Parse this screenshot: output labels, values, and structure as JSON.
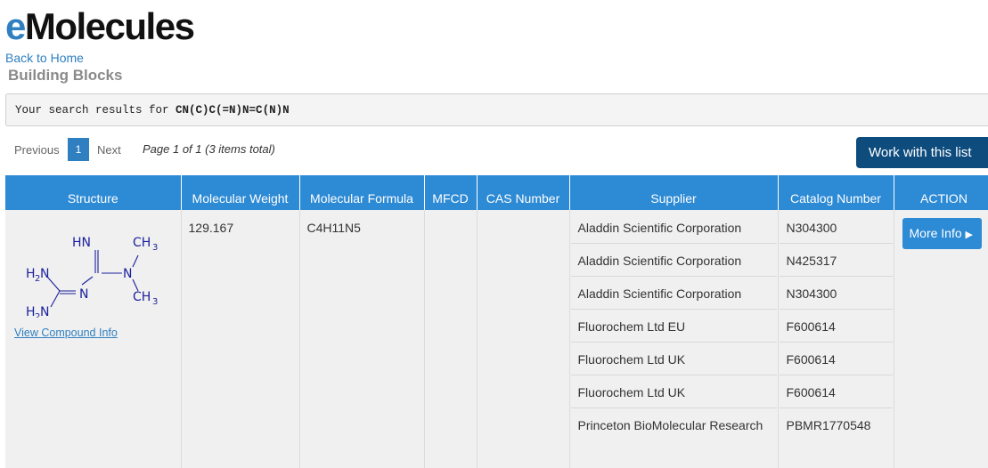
{
  "header": {
    "logo_prefix": "e",
    "logo_rest": "Molecules",
    "back_link": "Back to Home",
    "section_title": "Building Blocks"
  },
  "search": {
    "prefix": "Your search results for",
    "query": "CN(C)C(=N)N=C(N)N"
  },
  "pagination": {
    "previous": "Previous",
    "current_page": "1",
    "next": "Next",
    "info": "Page 1 of 1 (3 items total)"
  },
  "actions": {
    "work_with_list": "Work with this list"
  },
  "table": {
    "headers": {
      "structure": "Structure",
      "molecular_weight": "Molecular Weight",
      "molecular_formula": "Molecular Formula",
      "mfcd": "MFCD",
      "cas_number": "CAS Number",
      "supplier": "Supplier",
      "catalog_number": "Catalog Number",
      "action": "ACTION"
    },
    "row": {
      "structure_labels": {
        "hn": "HN",
        "ch3_top": "CH",
        "ch3_bottom": "CH",
        "sub3": "3",
        "n_mid": "N",
        "n_left": "N",
        "h2n_top": "H",
        "h2n_bottom": "H",
        "sub2": "2",
        "n_letter": "N"
      },
      "view_compound": "View Compound Info",
      "molecular_weight": "129.167",
      "molecular_formula": "C4H11N5",
      "mfcd": "",
      "cas_number": "",
      "more_info": "More Info",
      "suppliers": [
        {
          "name": "Aladdin Scientific Corporation",
          "catalog": "N304300"
        },
        {
          "name": "Aladdin Scientific Corporation",
          "catalog": "N425317"
        },
        {
          "name": "Aladdin Scientific Corporation",
          "catalog": "N304300"
        },
        {
          "name": "Fluorochem Ltd EU",
          "catalog": "F600614"
        },
        {
          "name": "Fluorochem Ltd UK",
          "catalog": "F600614"
        },
        {
          "name": "Fluorochem Ltd UK",
          "catalog": "F600614"
        },
        {
          "name": "Princeton BioMolecular Research",
          "catalog": "PBMR1770548"
        }
      ]
    }
  },
  "colors": {
    "brand_blue": "#2f7fc1",
    "header_blue": "#2d8ad5",
    "dark_button": "#0e4c7e"
  }
}
